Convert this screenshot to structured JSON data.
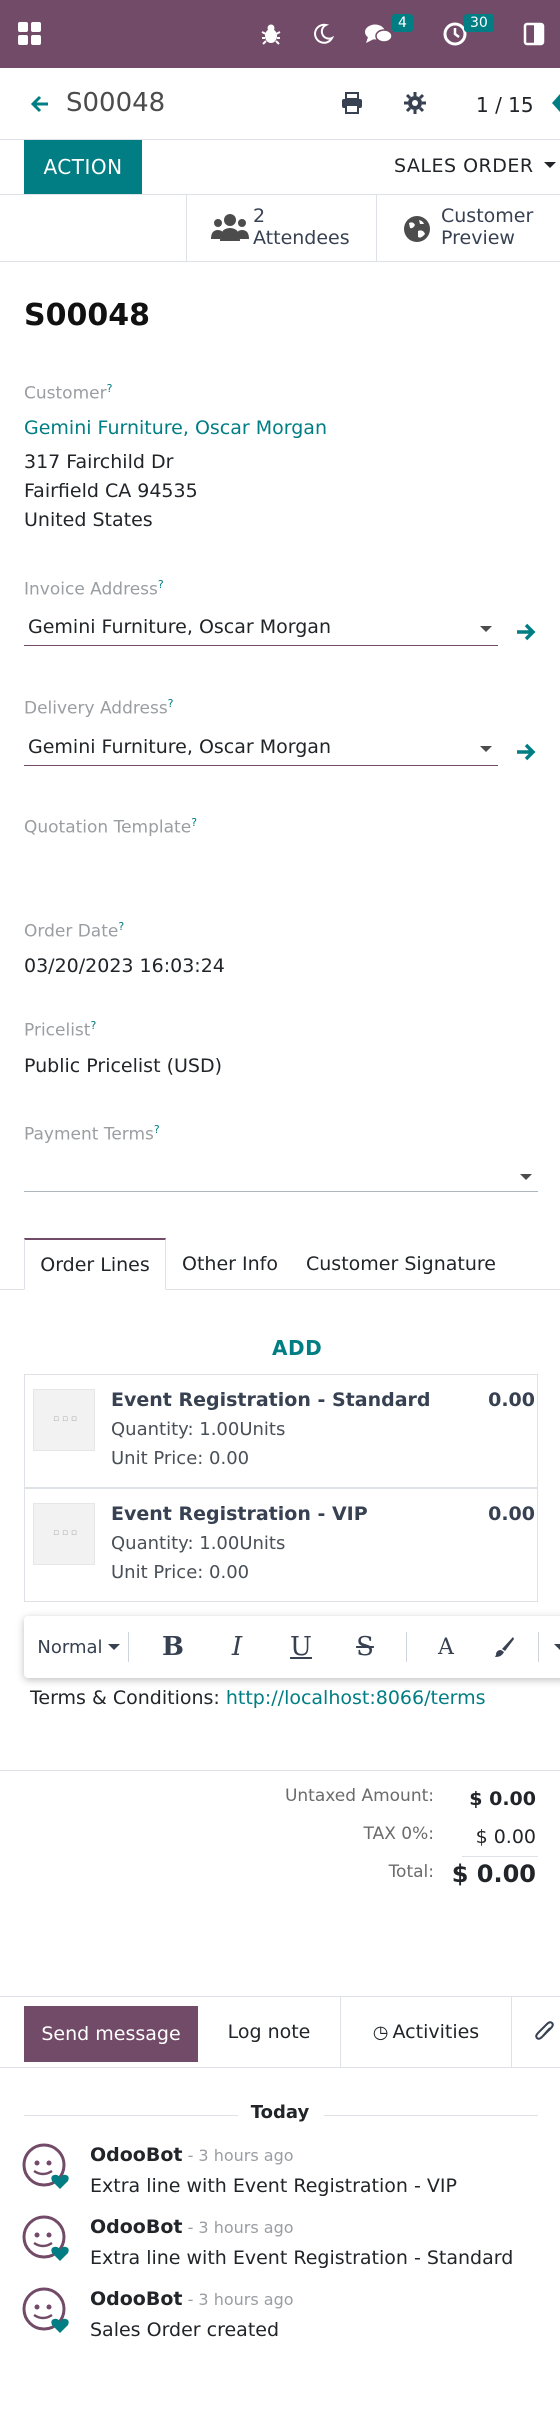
{
  "navbar": {
    "messages_count": "4",
    "activities_count": "30"
  },
  "control_panel": {
    "record_name": "S00048",
    "pager": "1 / 15"
  },
  "buttons": {
    "action": "ACTION",
    "status": "SALES ORDER"
  },
  "smart_buttons": {
    "attendees_count": "2",
    "attendees_label": "Attendees",
    "preview_line1": "Customer",
    "preview_line2": "Preview"
  },
  "form": {
    "title": "S00048",
    "customer_label": "Customer",
    "customer_name": "Gemini Furniture, Oscar Morgan",
    "address_line1": "317 Fairchild Dr",
    "address_line2": "Fairfield CA 94535",
    "address_line3": "United States",
    "invoice_label": "Invoice Address",
    "invoice_value": "Gemini Furniture, Oscar Morgan",
    "delivery_label": "Delivery Address",
    "delivery_value": "Gemini Furniture, Oscar Morgan",
    "template_label": "Quotation Template",
    "order_date_label": "Order Date",
    "order_date_value": "03/20/2023 16:03:24",
    "pricelist_label": "Pricelist",
    "pricelist_value": "Public Pricelist (USD)",
    "payment_terms_label": "Payment Terms",
    "payment_terms_value": ""
  },
  "tabs": [
    "Order Lines",
    "Other Info",
    "Customer Signature"
  ],
  "order_lines": {
    "add_label": "ADD",
    "lines": [
      {
        "product": "Event Registration - Standard",
        "quantity": "Quantity: 1.00Units",
        "unit_price": "Unit Price: 0.00",
        "subtotal": "0.00"
      },
      {
        "product": "Event Registration - VIP",
        "quantity": "Quantity: 1.00Units",
        "unit_price": "Unit Price: 0.00",
        "subtotal": "0.00"
      }
    ]
  },
  "editor_toolbar": {
    "style_label": "Normal",
    "bold": "B",
    "italic": "I",
    "underline": "U",
    "strike": "S",
    "font_color": "A"
  },
  "terms": {
    "label": "Terms & Conditions: ",
    "url": "http://localhost:8066/terms"
  },
  "totals": {
    "untaxed_label": "Untaxed Amount:",
    "untaxed_value": "$ 0.00",
    "tax_label": "TAX 0%:",
    "tax_value": "$ 0.00",
    "total_label": "Total:",
    "total_value": "$ 0.00"
  },
  "chatter": {
    "send_message": "Send message",
    "log_note": "Log note",
    "activities": "Activities",
    "today": "Today",
    "messages": [
      {
        "author": "OdooBot",
        "date": " - 3 hours ago",
        "body": "Extra line with Event Registration - VIP"
      },
      {
        "author": "OdooBot",
        "date": " - 3 hours ago",
        "body": "Extra line with Event Registration - Standard"
      },
      {
        "author": "OdooBot",
        "date": " - 3 hours ago",
        "body": "Sales Order created"
      }
    ]
  },
  "colors": {
    "brand": "#714b67",
    "accent": "#017e84",
    "border": "#dee2e6"
  },
  "icons": [
    "apps-grid-icon",
    "bug-icon",
    "moon-icon",
    "messages-icon",
    "clock-icon",
    "split-view-icon",
    "back-arrow-icon",
    "print-icon",
    "gear-icon",
    "users-icon",
    "globe-icon",
    "arrow-right-icon",
    "paperclip-icon",
    "brush-icon"
  ]
}
